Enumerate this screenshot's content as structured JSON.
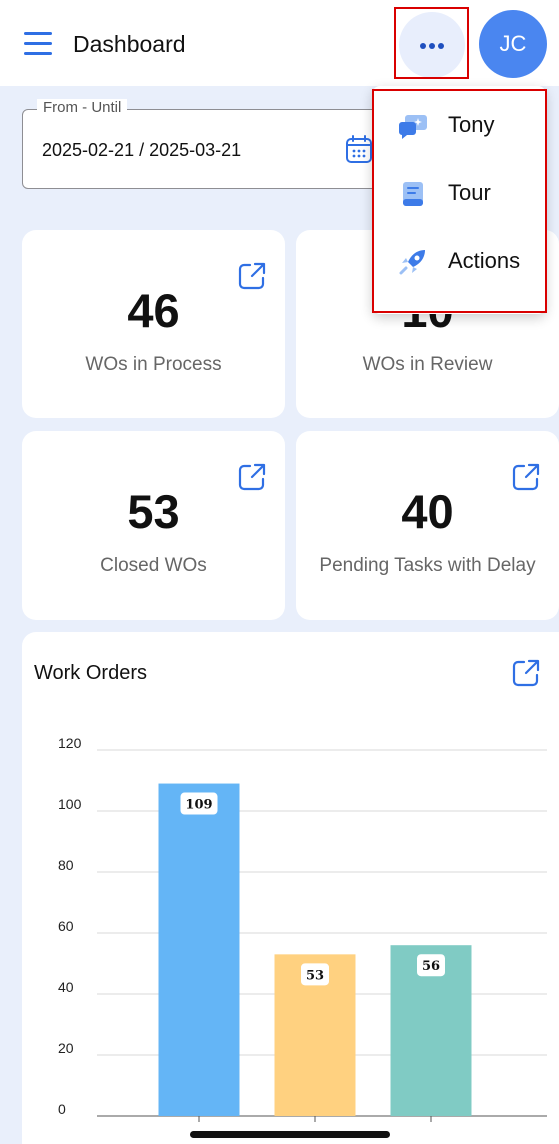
{
  "header": {
    "title": "Dashboard",
    "avatar_initials": "JC"
  },
  "date_filter": {
    "label": "From - Until",
    "value": "2025-02-21 / 2025-03-21"
  },
  "cards": [
    {
      "value": "46",
      "label": "WOs in Process"
    },
    {
      "value": "10",
      "label": "WOs in Review"
    },
    {
      "value": "53",
      "label": "Closed WOs"
    },
    {
      "value": "40",
      "label": "Pending Tasks with Delay"
    }
  ],
  "more_menu": {
    "items": [
      {
        "label": "Tony",
        "icon": "ai-chat-icon"
      },
      {
        "label": "Tour",
        "icon": "book-icon"
      },
      {
        "label": "Actions",
        "icon": "rocket-icon"
      }
    ]
  },
  "work_orders": {
    "title": "Work Orders"
  },
  "chart_data": {
    "type": "bar",
    "title": "Work Orders",
    "categories": [
      "",
      "",
      ""
    ],
    "values": [
      109,
      53,
      56
    ],
    "colors": [
      "#64b5f6",
      "#ffd180",
      "#80cbc4"
    ],
    "ylim": [
      0,
      120
    ],
    "yticks": [
      0,
      20,
      40,
      60,
      80,
      100,
      120
    ],
    "grid": true
  },
  "colors": {
    "accent": "#2f6fe4",
    "avatar": "#4a86f0",
    "highlight": "#d90000",
    "background": "#e9effb"
  }
}
